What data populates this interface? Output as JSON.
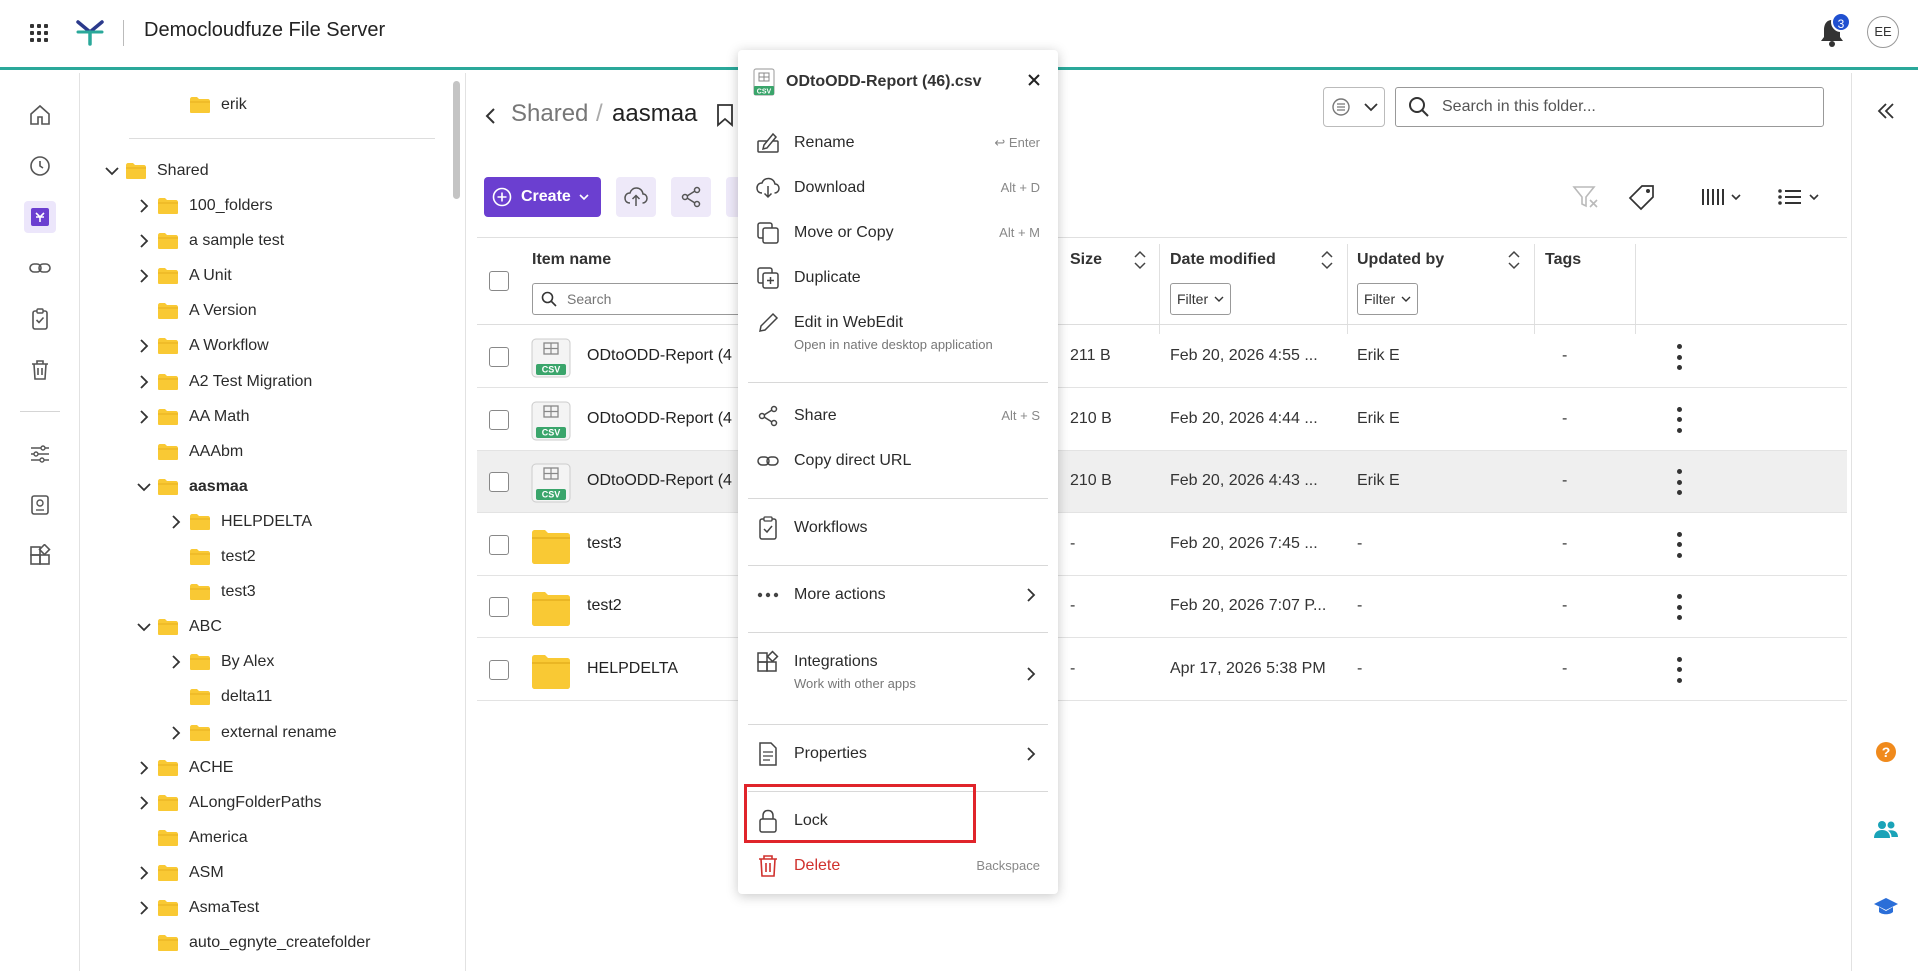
{
  "header": {
    "app_title": "Democloudfuze File Server",
    "notification_count": "3",
    "avatar_initials": "EE"
  },
  "tree": {
    "items": [
      {
        "label": "erik",
        "level": 2,
        "expandable": false
      },
      {
        "label": "Shared",
        "level": 0,
        "expandable": true,
        "expanded": true
      },
      {
        "label": "100_folders",
        "level": 1,
        "expandable": true
      },
      {
        "label": "a sample test",
        "level": 1,
        "expandable": true
      },
      {
        "label": "A Unit",
        "level": 1,
        "expandable": true
      },
      {
        "label": "A Version",
        "level": 1,
        "expandable": false
      },
      {
        "label": "A Workflow",
        "level": 1,
        "expandable": true
      },
      {
        "label": "A2 Test Migration",
        "level": 1,
        "expandable": true
      },
      {
        "label": "AA Math",
        "level": 1,
        "expandable": true
      },
      {
        "label": "AAAbm",
        "level": 1,
        "expandable": false
      },
      {
        "label": "aasmaa",
        "level": 1,
        "expandable": true,
        "expanded": true,
        "bold": true
      },
      {
        "label": "HELPDELTA",
        "level": 2,
        "expandable": true
      },
      {
        "label": "test2",
        "level": 2,
        "expandable": false
      },
      {
        "label": "test3",
        "level": 2,
        "expandable": false
      },
      {
        "label": "ABC",
        "level": 1,
        "expandable": true,
        "expanded": true
      },
      {
        "label": "By Alex",
        "level": 2,
        "expandable": true
      },
      {
        "label": "delta11",
        "level": 2,
        "expandable": false
      },
      {
        "label": "external rename",
        "level": 2,
        "expandable": true
      },
      {
        "label": "ACHE",
        "level": 1,
        "expandable": true
      },
      {
        "label": "ALongFolderPaths",
        "level": 1,
        "expandable": true
      },
      {
        "label": "America",
        "level": 1,
        "expandable": false
      },
      {
        "label": "ASM",
        "level": 1,
        "expandable": true
      },
      {
        "label": "AsmaTest",
        "level": 1,
        "expandable": true
      },
      {
        "label": "auto_egnyte_createfolder",
        "level": 1,
        "expandable": false
      }
    ]
  },
  "breadcrumb": {
    "parent": "Shared",
    "separator": "/",
    "current": "aasmaa"
  },
  "search": {
    "placeholder": "Search in this folder...",
    "value": ""
  },
  "toolbar": {
    "create_label": "Create"
  },
  "table": {
    "columns": {
      "name": "Item name",
      "size": "Size",
      "modified": "Date modified",
      "updated_by": "Updated by",
      "tags": "Tags"
    },
    "name_search_placeholder": "Search",
    "filter_label": "Filter",
    "rows": [
      {
        "name": "ODtoODD-Report (4",
        "type": "csv",
        "size": "211 B",
        "modified": "Feb 20, 2026 4:55 ...",
        "updated_by": "Erik E",
        "tags": "-"
      },
      {
        "name": "ODtoODD-Report (4",
        "type": "csv",
        "size": "210 B",
        "modified": "Feb 20, 2026 4:44 ...",
        "updated_by": "Erik E",
        "tags": "-"
      },
      {
        "name": "ODtoODD-Report (4",
        "type": "csv",
        "size": "210 B",
        "modified": "Feb 20, 2026 4:43 ...",
        "updated_by": "Erik E",
        "tags": "-",
        "selected": true
      },
      {
        "name": "test3",
        "type": "folder",
        "size": "-",
        "modified": "Feb 20, 2026 7:45 ...",
        "updated_by": "-",
        "tags": "-"
      },
      {
        "name": "test2",
        "type": "folder",
        "size": "-",
        "modified": "Feb 20, 2026 7:07 P...",
        "updated_by": "-",
        "tags": "-"
      },
      {
        "name": "HELPDELTA",
        "type": "folder",
        "size": "-",
        "modified": "Apr 17, 2026 5:38 PM",
        "updated_by": "-",
        "tags": "-"
      }
    ]
  },
  "context_menu": {
    "file_name": "ODtoODD-Report (46).csv",
    "file_badge": "CSV",
    "items": {
      "rename": {
        "label": "Rename",
        "shortcut": "↩ Enter"
      },
      "download": {
        "label": "Download",
        "shortcut": "Alt + D"
      },
      "move_copy": {
        "label": "Move or Copy",
        "shortcut": "Alt + M"
      },
      "duplicate": {
        "label": "Duplicate"
      },
      "edit_webedit": {
        "label": "Edit in WebEdit",
        "sub": "Open in native desktop application"
      },
      "share": {
        "label": "Share",
        "shortcut": "Alt + S"
      },
      "copy_url": {
        "label": "Copy direct URL"
      },
      "workflows": {
        "label": "Workflows"
      },
      "more_actions": {
        "label": "More actions"
      },
      "integrations": {
        "label": "Integrations",
        "sub": "Work with other apps"
      },
      "properties": {
        "label": "Properties"
      },
      "lock": {
        "label": "Lock"
      },
      "delete": {
        "label": "Delete",
        "shortcut": "Backspace"
      }
    }
  },
  "colors": {
    "accent_purple": "#6b3fd0",
    "teal_line": "#2aa89a",
    "folder_yellow": "#f9c934",
    "csv_green": "#3aa56b",
    "danger_red": "#d0312d",
    "highlight_red": "#e0242a"
  }
}
